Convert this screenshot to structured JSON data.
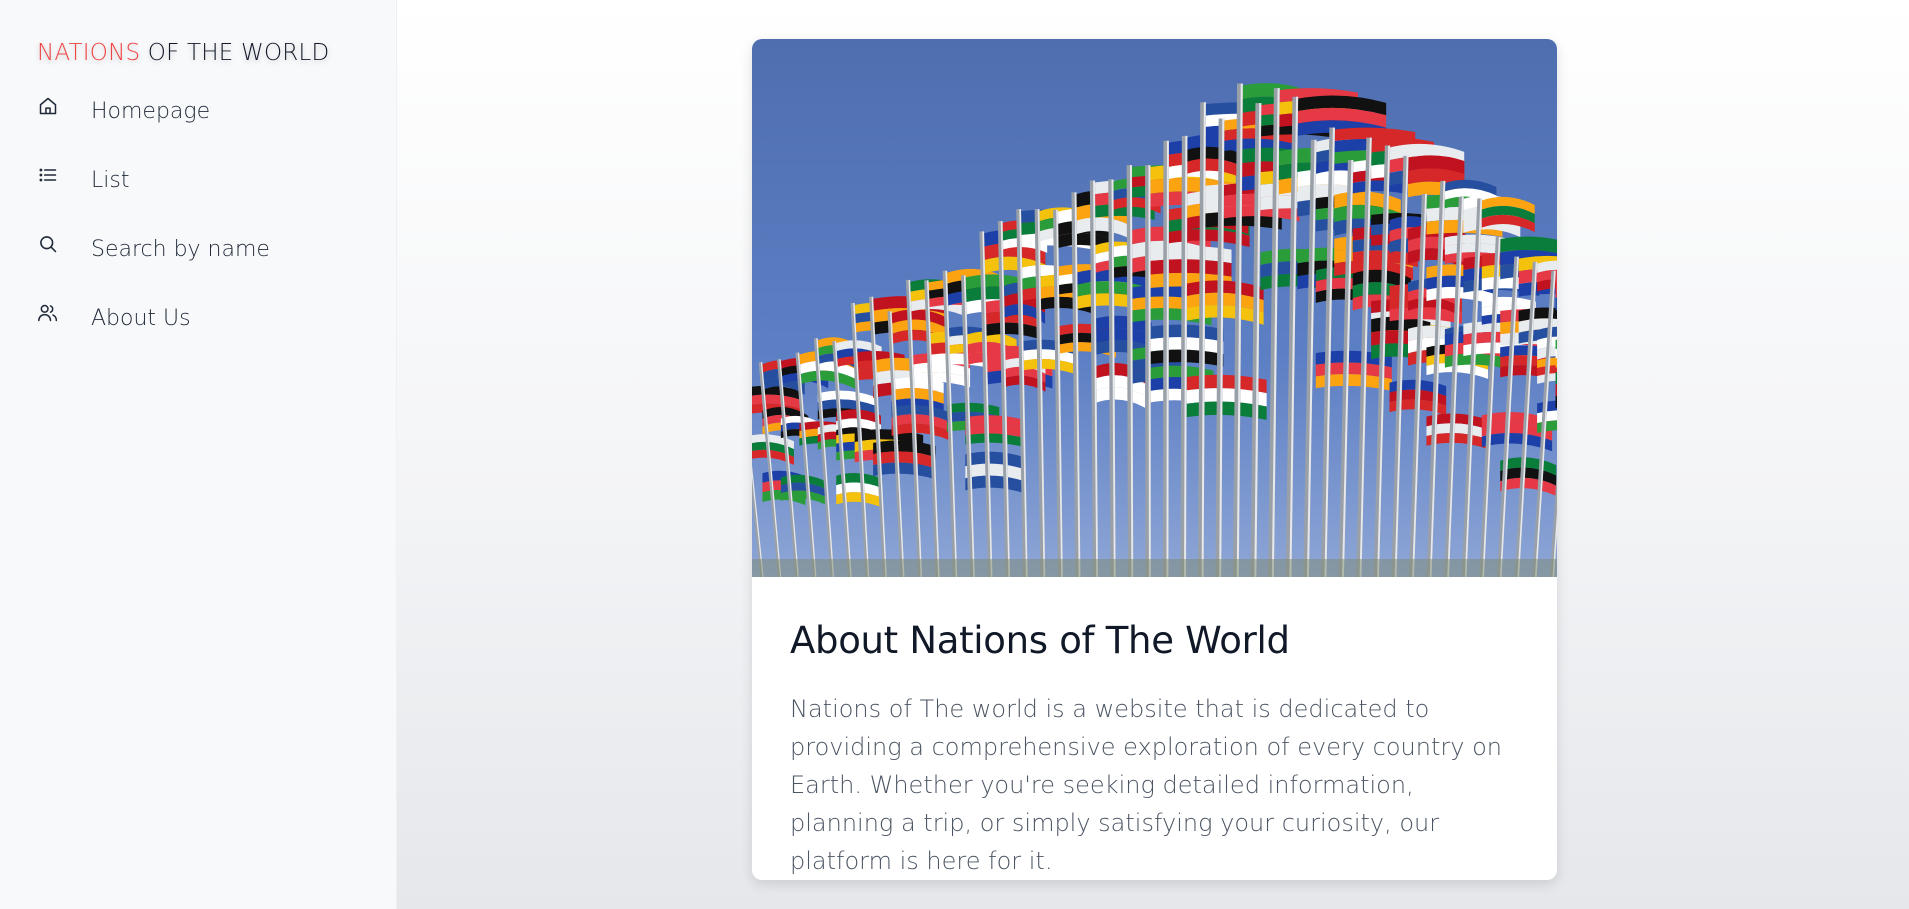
{
  "brand": {
    "accent": "NATIONS",
    "rest": " OF THE WORLD"
  },
  "sidebar": {
    "items": [
      {
        "label": "Homepage",
        "icon": "home-icon"
      },
      {
        "label": "List",
        "icon": "list-icon"
      },
      {
        "label": "Search by name",
        "icon": "search-icon"
      },
      {
        "label": "About Us",
        "icon": "users-icon"
      }
    ]
  },
  "card": {
    "image_subject": "flags-photo",
    "title": "About Nations of The World",
    "text": "Nations of The world is a website that is dedicated to providing a comprehensive exploration of every country on Earth. Whether you're seeking detailed information, planning a trip, or simply satisfying your curiosity, our platform is here for it."
  },
  "colors": {
    "accent": "#ef4444",
    "sidebar_bg": "#f8f9fb",
    "sky": "#5a78b8"
  }
}
